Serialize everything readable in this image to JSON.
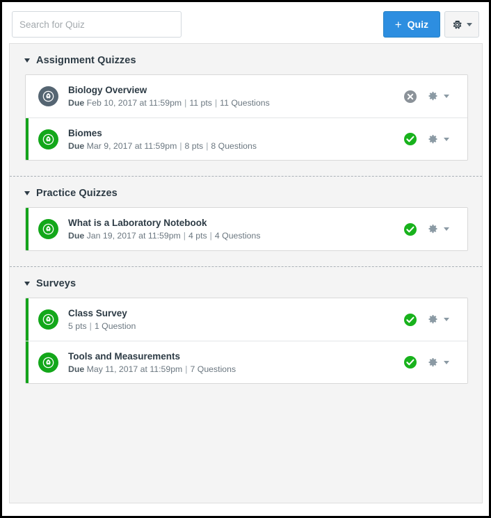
{
  "toolbar": {
    "search_placeholder": "Search for Quiz",
    "search_value": "",
    "add_quiz_label": "Quiz",
    "add_quiz_plus": "+",
    "gear_icon": "gear-icon",
    "caret_icon": "chevron-down-icon",
    "accent_color": "#2d8ee0"
  },
  "colors": {
    "published_green": "#13a71a",
    "unpublished_gray": "#556572",
    "panel_bg": "#f4f4f4",
    "text_dark": "#2d3b45",
    "text_muted": "#6b7780"
  },
  "groups": [
    {
      "title": "Assignment Quizzes",
      "collapse_icon": "chevron-down-icon",
      "rows": [
        {
          "title": "Biology Overview",
          "due_label": "Due",
          "due_date": "Feb 10, 2017 at 11:59pm",
          "points": "11 pts",
          "questions": "11 Questions",
          "published": false,
          "status_icon": "unpublished-x-icon",
          "icon": "quiz-rocket-icon",
          "gear_icon": "gear-icon",
          "caret_icon": "chevron-down-icon"
        },
        {
          "title": "Biomes",
          "due_label": "Due",
          "due_date": "Mar 9, 2017 at 11:59pm",
          "points": "8 pts",
          "questions": "8 Questions",
          "published": true,
          "status_icon": "published-check-icon",
          "icon": "quiz-rocket-icon",
          "gear_icon": "gear-icon",
          "caret_icon": "chevron-down-icon"
        }
      ]
    },
    {
      "title": "Practice Quizzes",
      "collapse_icon": "chevron-down-icon",
      "rows": [
        {
          "title": "What is a Laboratory Notebook",
          "due_label": "Due",
          "due_date": "Jan 19, 2017 at 11:59pm",
          "points": "4 pts",
          "questions": "4 Questions",
          "published": true,
          "status_icon": "published-check-icon",
          "icon": "quiz-rocket-icon",
          "gear_icon": "gear-icon",
          "caret_icon": "chevron-down-icon"
        }
      ]
    },
    {
      "title": "Surveys",
      "collapse_icon": "chevron-down-icon",
      "rows": [
        {
          "title": "Class Survey",
          "due_label": "",
          "due_date": "",
          "points": "5 pts",
          "questions": "1 Question",
          "published": true,
          "status_icon": "published-check-icon",
          "icon": "quiz-rocket-icon",
          "gear_icon": "gear-icon",
          "caret_icon": "chevron-down-icon"
        },
        {
          "title": "Tools and Measurements",
          "due_label": "Due",
          "due_date": "May 11, 2017 at 11:59pm",
          "points": "",
          "questions": "7 Questions",
          "published": true,
          "status_icon": "published-check-icon",
          "icon": "quiz-rocket-icon",
          "gear_icon": "gear-icon",
          "caret_icon": "chevron-down-icon"
        }
      ]
    }
  ]
}
